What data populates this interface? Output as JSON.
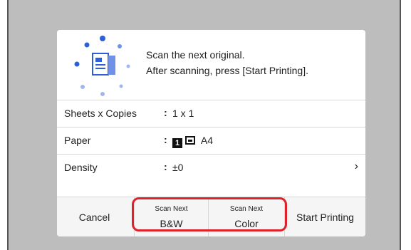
{
  "message": {
    "line1": "Scan the next original.",
    "line2": "After scanning, press [Start Printing]."
  },
  "settings": [
    {
      "label": "Sheets x Copies",
      "colon": ":",
      "value": "1 x 1"
    },
    {
      "label": "Paper",
      "colon": ":",
      "value": "A4",
      "tray": "1"
    },
    {
      "label": "Density",
      "colon": ":",
      "value": "±0",
      "chevron": "›"
    }
  ],
  "buttons": {
    "cancel": "Cancel",
    "scan_next_bw_top": "Scan Next",
    "scan_next_bw_bottom": "B&W",
    "scan_next_color_top": "Scan Next",
    "scan_next_color_bottom": "Color",
    "start": "Start Printing"
  },
  "colors": {
    "accent_blue": "#2c5fd8",
    "highlight_red": "#e0202a"
  },
  "icons": {
    "progress": "scanning-progress-icon",
    "tray": "paper-tray-1-icon",
    "paper_size": "paper-size-icon",
    "chevron": "chevron-right-icon"
  }
}
